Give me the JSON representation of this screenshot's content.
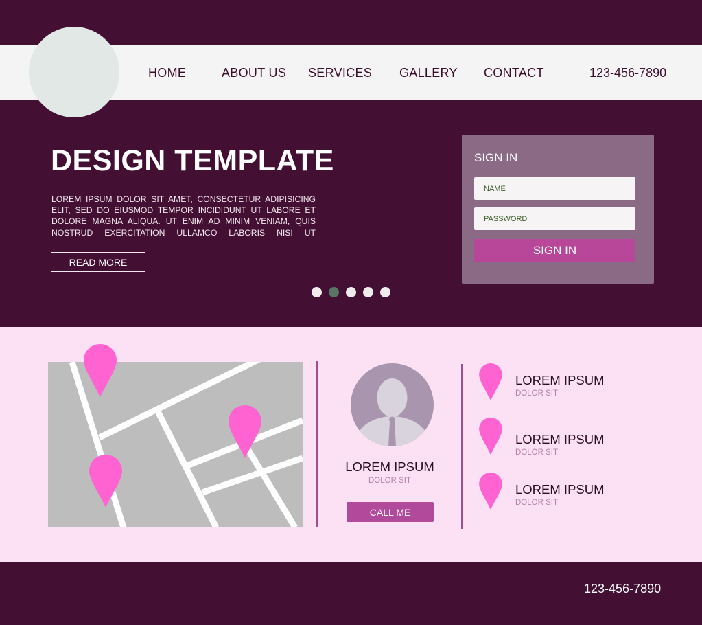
{
  "colors": {
    "dark_plum": "#430f32",
    "nav_bg": "#f5f4f5",
    "panel_bg": "#8a6a84",
    "accent": "#b8479a",
    "light_pink": "#fce0f4",
    "pin": "#ff63d2",
    "map_gray": "#bdbdbd"
  },
  "header": {
    "logo": "logo-placeholder",
    "nav": [
      {
        "label": "HOME"
      },
      {
        "label": "ABOUT US"
      },
      {
        "label": "SERVICES"
      },
      {
        "label": "GALLERY"
      },
      {
        "label": "CONTACT"
      }
    ],
    "phone": "123-456-7890"
  },
  "hero": {
    "title": "DESIGN TEMPLATE",
    "body": "LOREM IPSUM DOLOR SIT AMET, CONSECTETUR ADIPISICING ELIT, SED DO EIUSMOD TEMPOR INCIDIDUNT UT LABORE ET DOLORE MAGNA ALIQUA. UT ENIM AD MINIM VENIAM, QUIS NOSTRUD EXERCITATION ULLAMCO LABORIS NISI UT",
    "read_more_label": "READ MORE",
    "slider": {
      "count": 5,
      "active_index": 1
    }
  },
  "signin": {
    "title": "SIGN IN",
    "name_placeholder": "NAME",
    "password_placeholder": "PASSWORD",
    "name_value": "",
    "password_value": "",
    "button_label": "SIGN IN"
  },
  "map": {
    "icon": "map-pin-icon",
    "pins": 3
  },
  "profile_card": {
    "avatar_icon": "user-avatar-icon",
    "name": "LOREM IPSUM",
    "subtitle": "DOLOR SIT",
    "button_label": "CALL ME"
  },
  "locations": [
    {
      "title": "LOREM IPSUM",
      "subtitle": "DOLOR SIT",
      "icon": "map-pin-icon"
    },
    {
      "title": "LOREM IPSUM",
      "subtitle": "DOLOR SIT",
      "icon": "map-pin-icon"
    },
    {
      "title": "LOREM IPSUM",
      "subtitle": "DOLOR SIT",
      "icon": "map-pin-icon"
    }
  ],
  "footer": {
    "phone": "123-456-7890"
  }
}
